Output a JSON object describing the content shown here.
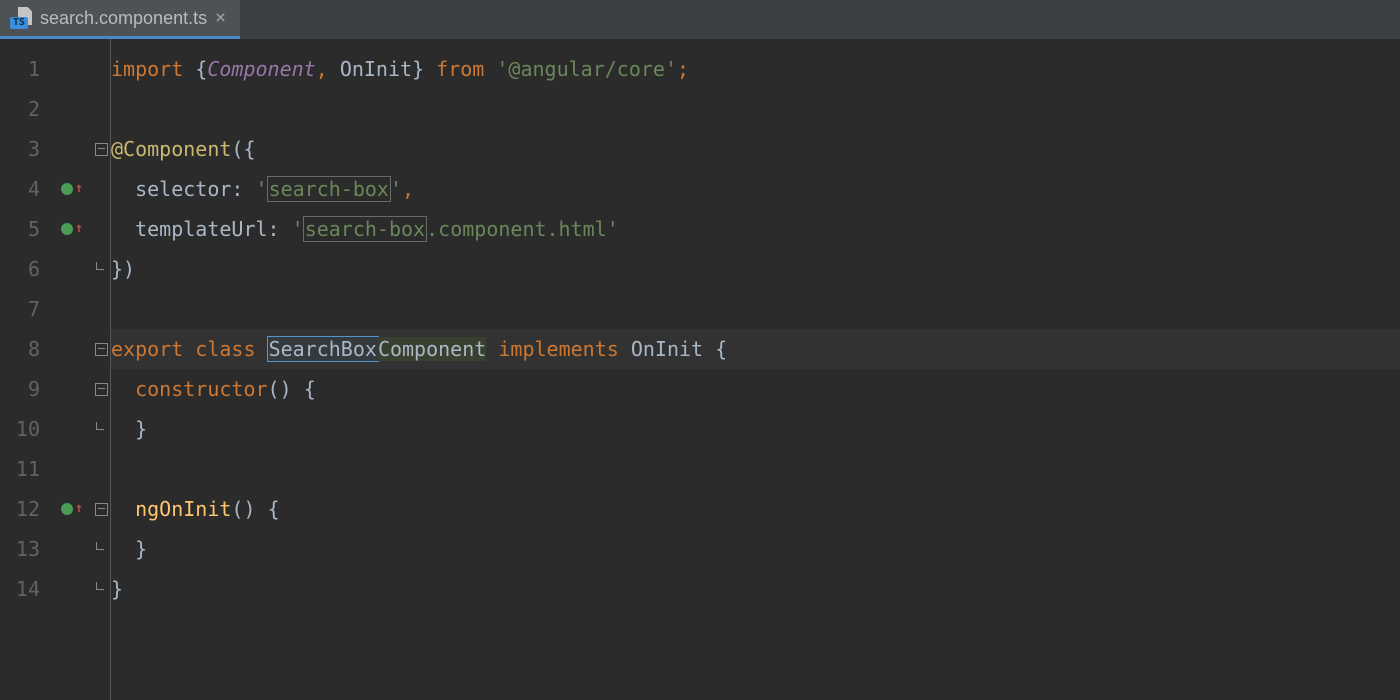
{
  "tab": {
    "filename": "search.component.ts",
    "file_type_badge": "TS",
    "close_glyph": "×"
  },
  "gutter": {
    "lines": [
      "1",
      "2",
      "3",
      "4",
      "5",
      "6",
      "7",
      "8",
      "9",
      "10",
      "11",
      "12",
      "13",
      "14"
    ],
    "marks": {
      "4": {
        "dot": true,
        "arrow": true
      },
      "5": {
        "dot": true,
        "arrow": true
      },
      "12": {
        "dot": true,
        "arrow": true
      }
    }
  },
  "code": {
    "current_line": 8,
    "tokens": {
      "l1": {
        "import": "import",
        "lb": "{",
        "Component": "Component",
        "comma": ",",
        "sp": " ",
        "OnInit": "OnInit",
        "rb": "}",
        "from": "from",
        "pkg": "'@angular/core'",
        "semi": ";"
      },
      "l3": {
        "at": "@",
        "Component": "Component",
        "paren": "({"
      },
      "l4": {
        "indent": "  ",
        "selector": "selector",
        "colon": ": ",
        "q1": "'",
        "val": "search-box",
        "q2": "'",
        "comma": ","
      },
      "l5": {
        "indent": "  ",
        "templateUrl": "templateUrl",
        "colon": ": ",
        "q1": "'",
        "val1": "search-box",
        "val2": ".component.html",
        "q2": "'"
      },
      "l6": {
        "close": "})"
      },
      "l8": {
        "export": "export",
        "sp": " ",
        "class": "class",
        "sp2": " ",
        "SearchBox": "SearchBox",
        "Component": "Component",
        "sp3": " ",
        "implements": "implements",
        "sp4": " ",
        "OnInit": "OnInit",
        "sp5": " ",
        "brace": "{"
      },
      "l9": {
        "indent": "  ",
        "constructor": "constructor",
        "paren": "()",
        "sp": " ",
        "brace": "{"
      },
      "l10": {
        "indent": "  ",
        "brace": "}"
      },
      "l12": {
        "indent": "  ",
        "ngOnInit": "ngOnInit",
        "paren": "()",
        "sp": " ",
        "brace": "{"
      },
      "l13": {
        "indent": "  ",
        "brace": "}"
      },
      "l14": {
        "brace": "}"
      }
    }
  }
}
